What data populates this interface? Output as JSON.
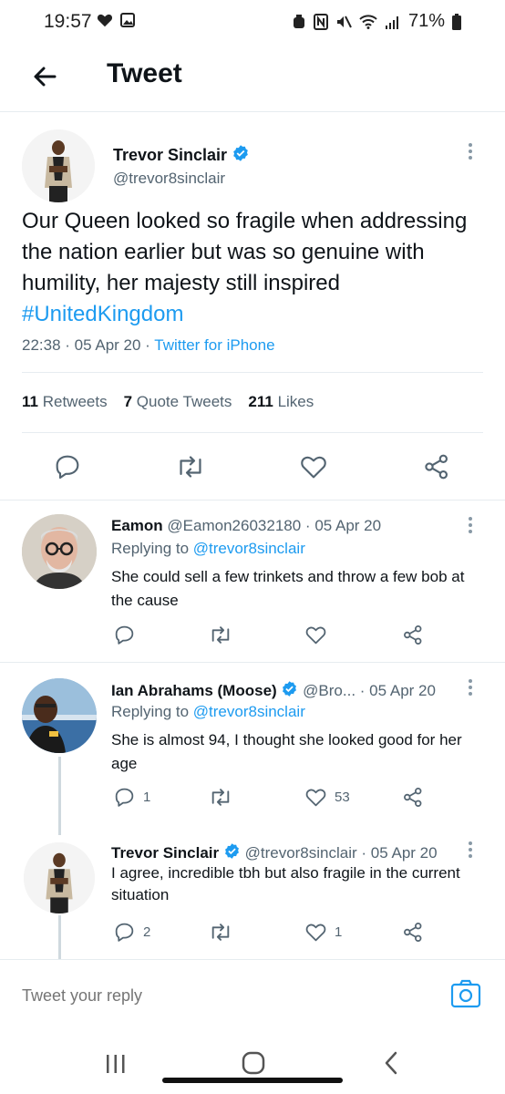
{
  "status_bar": {
    "time": "19:57",
    "battery": "71%"
  },
  "header": {
    "title": "Tweet"
  },
  "main_tweet": {
    "author_name": "Trevor Sinclair",
    "author_handle": "@trevor8sinclair",
    "text_before": "Our Queen looked so fragile when addressing the nation earlier but was so genuine with humility, her majesty still inspired ",
    "hashtag": "#UnitedKingdom",
    "time": "22:38",
    "date": "05 Apr 20",
    "source": "Twitter for iPhone",
    "stats": {
      "retweets_count": "11",
      "retweets_label": "Retweets",
      "quotes_count": "7",
      "quotes_label": "Quote Tweets",
      "likes_count": "211",
      "likes_label": "Likes"
    }
  },
  "replies": [
    {
      "author_name": "Eamon",
      "author_handle": "@Eamon26032180",
      "date": "05 Apr 20",
      "replying_prefix": "Replying to ",
      "replying_to": "@trevor8sinclair",
      "text": "She could sell a few trinkets and throw a few bob at the cause",
      "reply_count": "",
      "like_count": ""
    },
    {
      "author_name": "Ian Abrahams (Moose)",
      "author_handle": "@Bro...",
      "date": "05 Apr 20",
      "replying_prefix": "Replying to ",
      "replying_to": "@trevor8sinclair",
      "text": "She is almost 94, I thought she looked good for her age",
      "reply_count": "1",
      "like_count": "53"
    },
    {
      "author_name": "Trevor Sinclair",
      "author_handle": "@trevor8sinclair",
      "date": "05 Apr 20",
      "text": "I agree, incredible tbh but also fragile in the current situation",
      "reply_count": "2",
      "like_count": "1"
    }
  ],
  "reply_bar": {
    "placeholder": "Tweet your reply"
  },
  "colors": {
    "link": "#1d9bf0",
    "text": "#0f1419",
    "secondary": "#536471",
    "verified": "#1d9bf0"
  }
}
